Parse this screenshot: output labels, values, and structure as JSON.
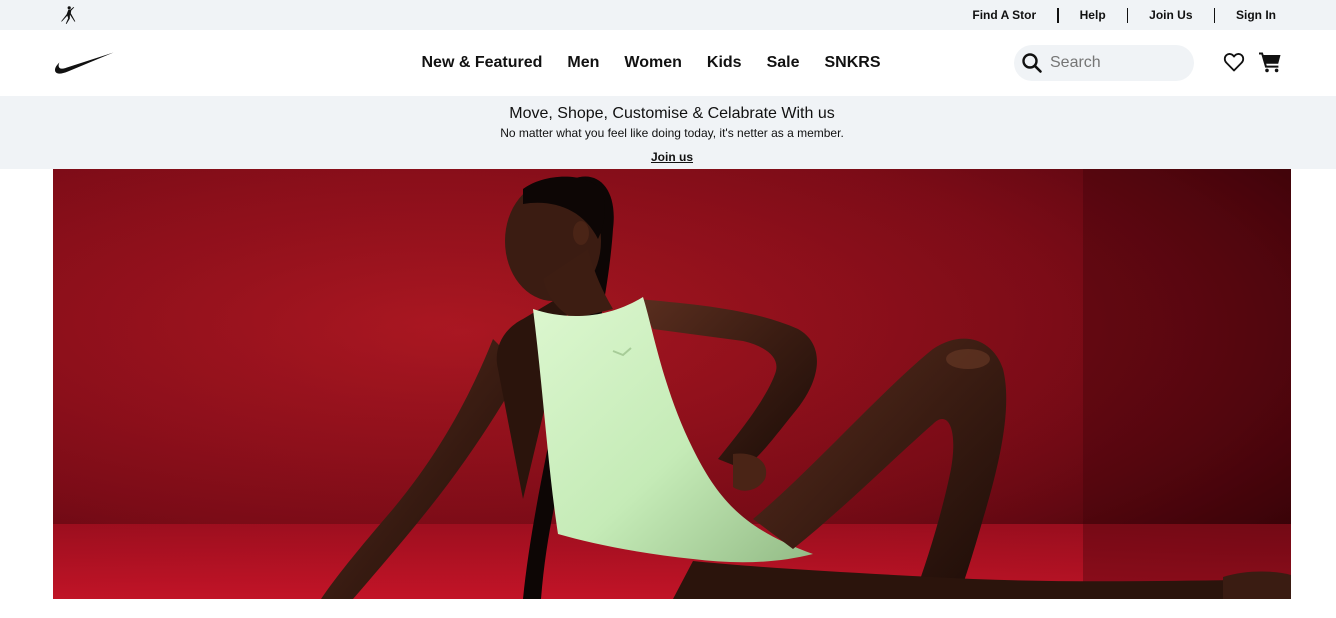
{
  "utility": {
    "logo": "jordan-jumpman-icon",
    "links": [
      "Find A Stor",
      "Help",
      "Join Us",
      "Sign In"
    ]
  },
  "header": {
    "logo": "nike-swoosh-icon",
    "nav": [
      "New & Featured",
      "Men",
      "Women",
      "Kids",
      "Sale",
      "SNKRS"
    ],
    "search": {
      "placeholder": "Search",
      "value": ""
    },
    "icons": [
      "heart-icon",
      "cart-icon"
    ]
  },
  "promo": {
    "title": "Move, Shope, Customise & Celabrate With us",
    "subtitle": "No matter what you feel like doing today, it's netter as a member.",
    "link": "Join us"
  },
  "colors": {
    "bar_bg": "#f0f3f6",
    "hero_red": "#8c0f1b",
    "bodysuit": "#c9ecbd",
    "skin": "#3a1c12"
  }
}
